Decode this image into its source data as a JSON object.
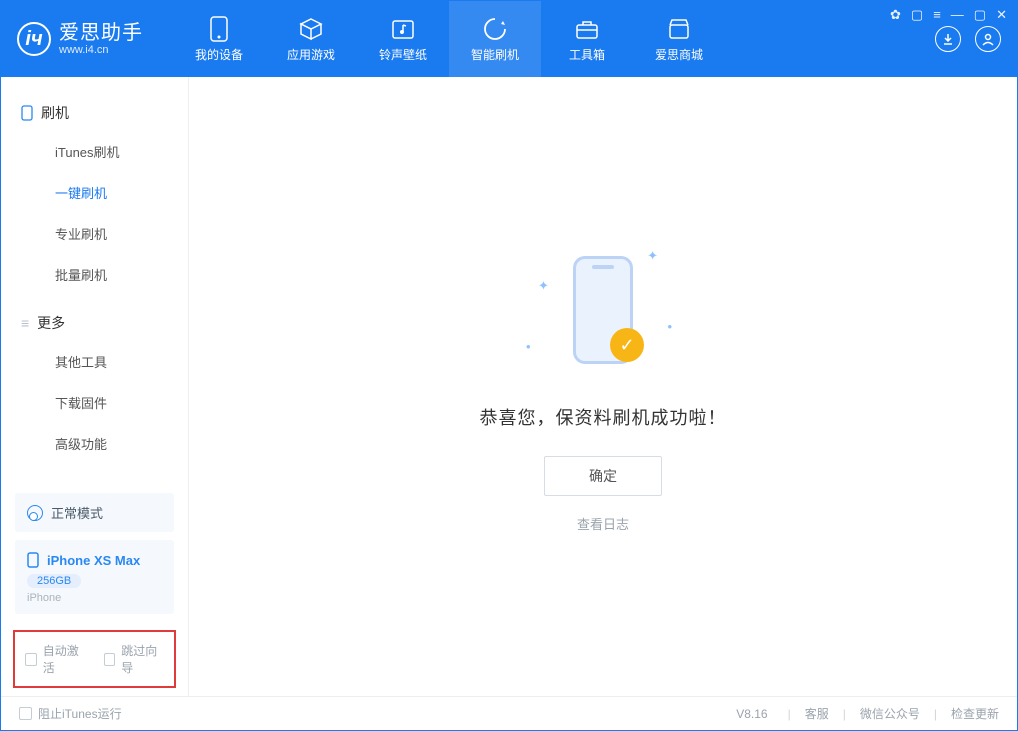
{
  "app": {
    "name": "爱思助手",
    "site": "www.i4.cn",
    "logo_letter": "іч"
  },
  "nav": {
    "tabs": [
      {
        "label": "我的设备"
      },
      {
        "label": "应用游戏"
      },
      {
        "label": "铃声壁纸"
      },
      {
        "label": "智能刷机"
      },
      {
        "label": "工具箱"
      },
      {
        "label": "爱思商城"
      }
    ],
    "active_index": 3
  },
  "sidebar": {
    "group1": {
      "title": "刷机",
      "items": [
        "iTunes刷机",
        "一键刷机",
        "专业刷机",
        "批量刷机"
      ],
      "active_index": 1
    },
    "group2": {
      "title": "更多",
      "items": [
        "其他工具",
        "下载固件",
        "高级功能"
      ]
    }
  },
  "device": {
    "mode": "正常模式",
    "name": "iPhone XS Max",
    "storage": "256GB",
    "type": "iPhone"
  },
  "redbox": {
    "opt1": "自动激活",
    "opt2": "跳过向导"
  },
  "main": {
    "message": "恭喜您，保资料刷机成功啦！",
    "ok": "确定",
    "log_link": "查看日志"
  },
  "footer": {
    "block_itunes": "阻止iTunes运行",
    "version": "V8.16",
    "links": [
      "客服",
      "微信公众号",
      "检查更新"
    ]
  }
}
